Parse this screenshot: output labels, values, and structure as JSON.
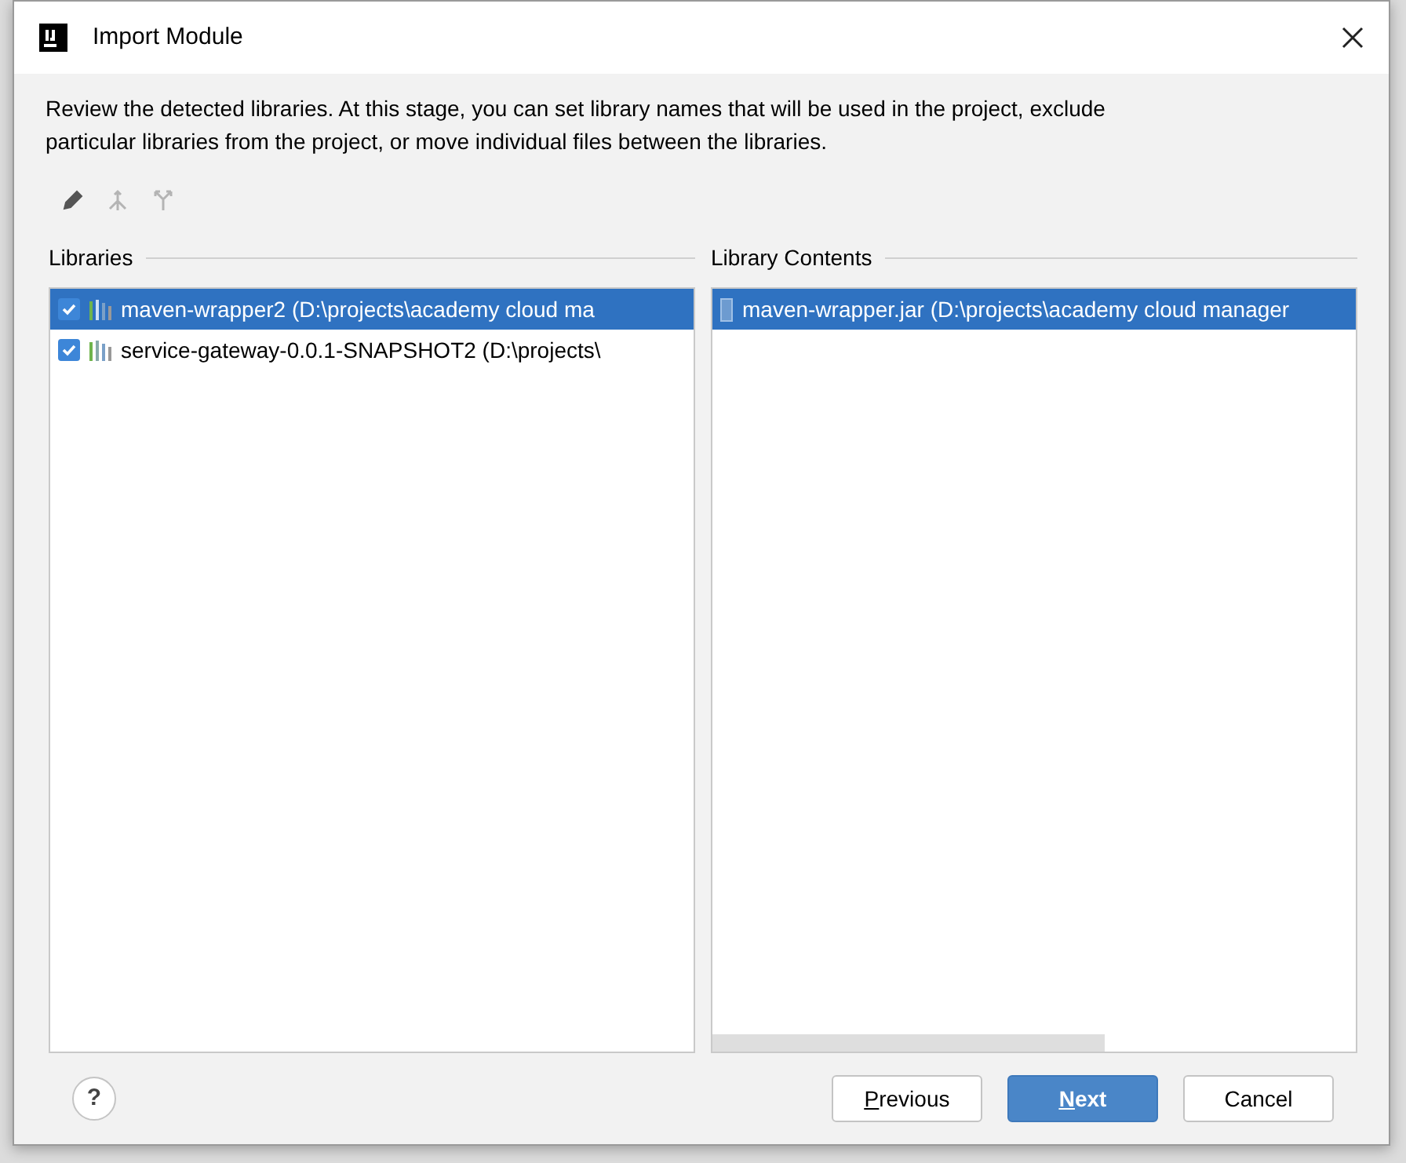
{
  "window": {
    "title": "Import Module"
  },
  "description": "Review the detected libraries. At this stage, you can set library names that will be used in the project, exclude particular libraries from the project, or move individual files between the libraries.",
  "toolbar": [
    {
      "kind": "edit",
      "disabled": false
    },
    {
      "kind": "merge",
      "disabled": true
    },
    {
      "kind": "split",
      "disabled": true
    }
  ],
  "libraries": {
    "title": "Libraries",
    "items": [
      {
        "label": "maven-wrapper2 (D:\\projects\\academy cloud ma",
        "checked": true,
        "selected": true
      },
      {
        "label": "service-gateway-0.0.1-SNAPSHOT2 (D:\\projects\\",
        "checked": true,
        "selected": false
      }
    ]
  },
  "library_contents": {
    "title": "Library Contents",
    "items": [
      {
        "label": "maven-wrapper.jar (D:\\projects\\academy cloud manager",
        "selected": true
      }
    ]
  },
  "buttons": [
    {
      "kind": "help",
      "label": "?"
    },
    {
      "kind": "normal",
      "label": "Previous",
      "mnemonic": true
    },
    {
      "kind": "default",
      "label": "Next",
      "mnemonic": true
    },
    {
      "kind": "normal",
      "label": "Cancel",
      "mnemonic": false
    }
  ]
}
